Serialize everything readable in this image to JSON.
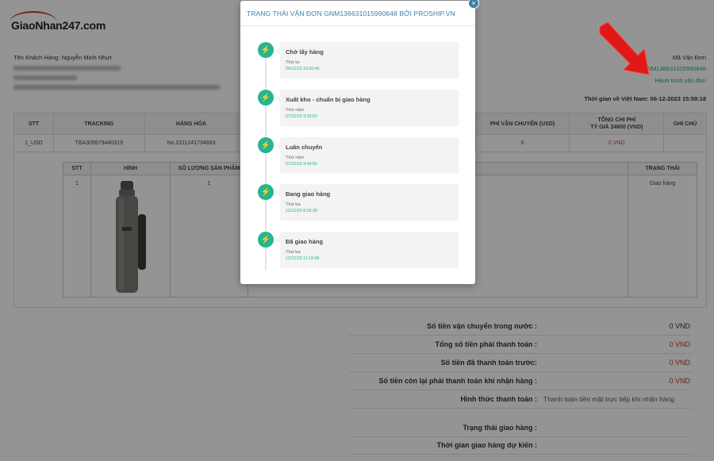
{
  "logo": {
    "text": "GiaoNhan247.com"
  },
  "customer": {
    "label": "Tên Khách Hàng: Nguyễn Minh Nhựt"
  },
  "right_info": {
    "code_label": "Mã Vận Đơn",
    "code_value": "GNM136631015990648",
    "journey_link": "Hành trình vận đơn",
    "time_text": "Thời gian về Việt Nam: 06-12-2023 15:59:18"
  },
  "main_table": {
    "headers": [
      "STT",
      "TRACKING",
      "HÀNG HÓA",
      "",
      "PHÍ VẬN CHUYỂN (USD)",
      "TỔNG CHI PHÍ\nTỶ GIÁ 24600 (VND)",
      "GHI CHÚ"
    ],
    "row": [
      "1_USD",
      "TBA309979440319",
      "No.2311241734883",
      "",
      "0",
      "0 VND",
      ""
    ]
  },
  "sub_table": {
    "headers": [
      "STT",
      "HÌNH",
      "SỐ LƯỢNG SẢN PHẨM",
      "",
      "TRẠNG THÁI"
    ],
    "row": [
      "1",
      "",
      "1",
      "",
      "Giao hàng"
    ]
  },
  "summary": [
    {
      "label": "Số tiền vận chuyển trong nước :",
      "value": "0 VND",
      "color": "#333333"
    },
    {
      "label": "Tổng số tiền phải thanh toán :",
      "value": "0 VND",
      "color": "#c0392b"
    },
    {
      "label": "Số tiền đã thanh toán trước:",
      "value": "0 VND",
      "color": "#c0392b"
    },
    {
      "label": "Số tiền còn lại phải thanh toán khi nhận hàng :",
      "value": "0 VND",
      "color": "#c0392b"
    },
    {
      "label": "Hình thức thanh toán :",
      "value": "Thanh toán tiền mặt trực tiếp khi nhận hàng",
      "color": "#555555"
    },
    {
      "label": "Trạng thái giao hàng :",
      "value": "",
      "color": "#333333"
    },
    {
      "label": "Thời gian giao hàng dự kiến :",
      "value": "",
      "color": "#333333"
    }
  ],
  "modal": {
    "title": "TRẠNG THÁI VẬN ĐƠN GNM136631015990648 BỞI PROSHIP.VN",
    "close_icon": "×",
    "events": [
      {
        "status": "Chờ lấy hàng",
        "day": "Thứ tư",
        "time": "06/12/23 18:50:46"
      },
      {
        "status": "Xuất kho - chuẩn bị giao hàng",
        "day": "Thứ năm",
        "time": "07/12/23 9:33:52"
      },
      {
        "status": "Luân chuyển",
        "day": "Thứ năm",
        "time": "07/12/23 9:44:56"
      },
      {
        "status": "Đang giao hàng",
        "day": "Thứ ba",
        "time": "12/12/23 8:28:38"
      },
      {
        "status": "Đã giao hàng",
        "day": "Thứ ba",
        "time": "12/12/23 11:19:48"
      }
    ],
    "event_icon": "bolt-icon"
  },
  "colors": {
    "accent": "#26b58f",
    "title": "#3a7fa8",
    "brand_red": "#c0392b"
  }
}
